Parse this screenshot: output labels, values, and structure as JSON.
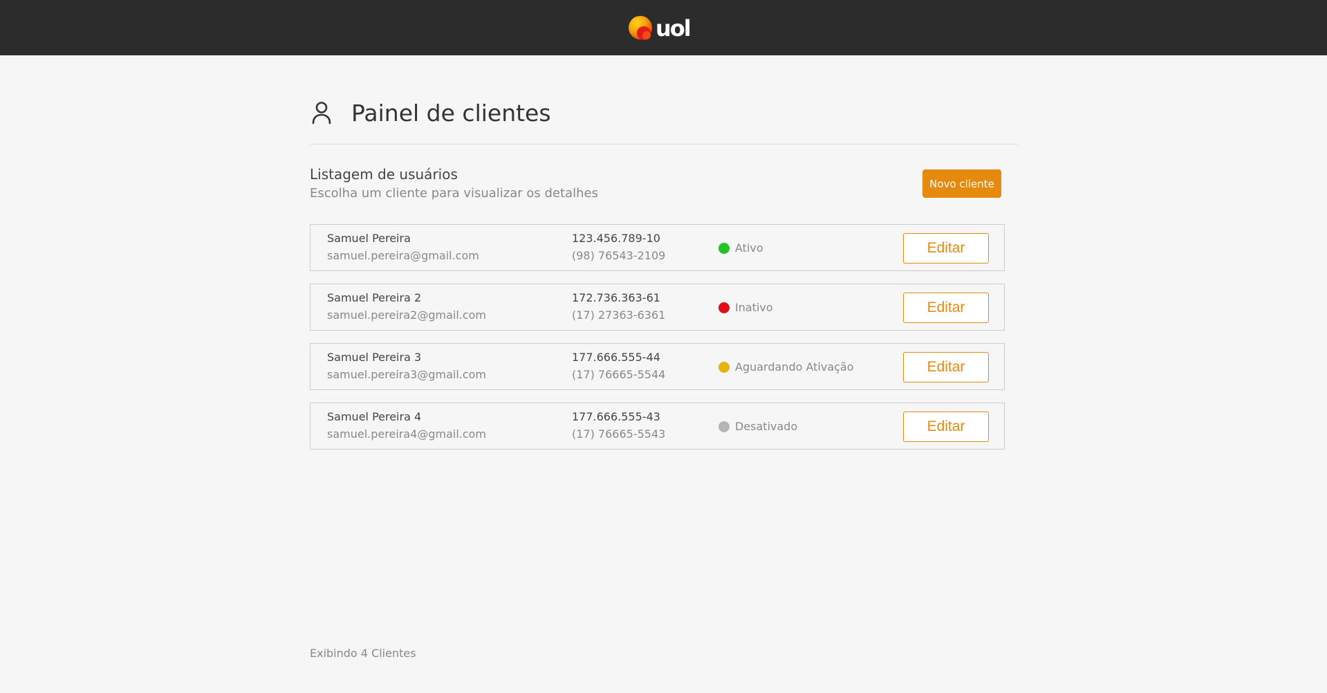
{
  "brand": {
    "logo_text": "uol",
    "accent_color": "#e6890f"
  },
  "header": {
    "icon": "user-icon",
    "title": "Painel de clientes"
  },
  "section": {
    "title": "Listagem de usuários",
    "subtitle": "Escolha um cliente para visualizar os detalhes",
    "new_button_label": "Novo cliente"
  },
  "clients": [
    {
      "name": "Samuel Pereira",
      "email": "samuel.pereira@gmail.com",
      "document": "123.456.789-10",
      "phone": "(98) 76543-2109",
      "status": "Ativo",
      "status_color": "#1ec523",
      "edit_label": "Editar"
    },
    {
      "name": "Samuel Pereira 2",
      "email": "samuel.pereira2@gmail.com",
      "document": "172.736.363-61",
      "phone": "(17) 27363-6361",
      "status": "Inativo",
      "status_color": "#e0101a",
      "edit_label": "Editar"
    },
    {
      "name": "Samuel Pereira 3",
      "email": "samuel.pereira3@gmail.com",
      "document": "177.666.555-44",
      "phone": "(17) 76665-5544",
      "status": "Aguardando Ativação",
      "status_color": "#e6b211",
      "edit_label": "Editar"
    },
    {
      "name": "Samuel Pereira 4",
      "email": "samuel.pereira4@gmail.com",
      "document": "177.666.555-43",
      "phone": "(17) 76665-5543",
      "status": "Desativado",
      "status_color": "#b5b5b5",
      "edit_label": "Editar"
    }
  ],
  "footer": {
    "count_text": "Exibindo 4 Clientes"
  }
}
